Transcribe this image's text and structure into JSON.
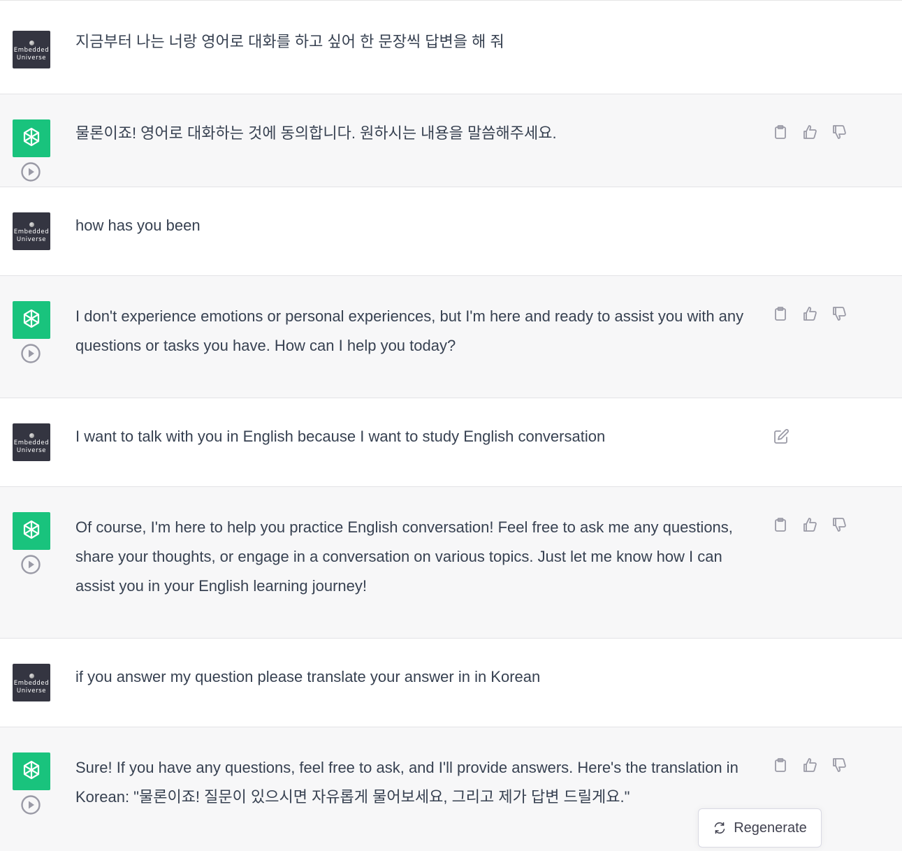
{
  "user": {
    "avatar_line1": "Embedded",
    "avatar_line2": "Universe"
  },
  "messages": [
    {
      "role": "user",
      "text": "지금부터 나는 너랑 영어로 대화를 하고 싶어 한 문장씩 답변을 해 줘"
    },
    {
      "role": "assistant",
      "text": "물론이죠! 영어로 대화하는 것에 동의합니다. 원하시는 내용을 말씀해주세요."
    },
    {
      "role": "user",
      "text": "how has you been"
    },
    {
      "role": "assistant",
      "text": "I don't experience emotions or personal experiences, but I'm here and ready to assist you with any questions or tasks you have. How can I help you today?"
    },
    {
      "role": "user",
      "text": "I want to talk with you in English because I want to study English conversation"
    },
    {
      "role": "assistant",
      "text": "Of course, I'm here to help you practice English conversation! Feel free to ask me any questions, share your thoughts, or engage in a conversation on various topics. Just let me know how I can assist you in your English learning journey!"
    },
    {
      "role": "user",
      "text": "if you answer my question please translate your answer in in Korean"
    },
    {
      "role": "assistant",
      "text": "Sure! If you have any questions, feel free to ask, and I'll provide answers. Here's the translation in Korean: \"물론이죠! 질문이 있으시면 자유롭게 물어보세요, 그리고 제가 답변 드릴게요.\""
    }
  ],
  "actions": {
    "regenerate_label": "Regenerate"
  },
  "icons": {
    "bot_avatar": "openai-logo-icon",
    "play": "play-circle-icon",
    "copy": "clipboard-icon",
    "like": "thumbs-up-icon",
    "dislike": "thumbs-down-icon",
    "edit": "edit-icon",
    "regenerate": "refresh-icon"
  },
  "colors": {
    "bot_avatar_bg": "#19c37d",
    "user_avatar_bg": "#343541",
    "assistant_row_bg": "#f7f7f8"
  }
}
